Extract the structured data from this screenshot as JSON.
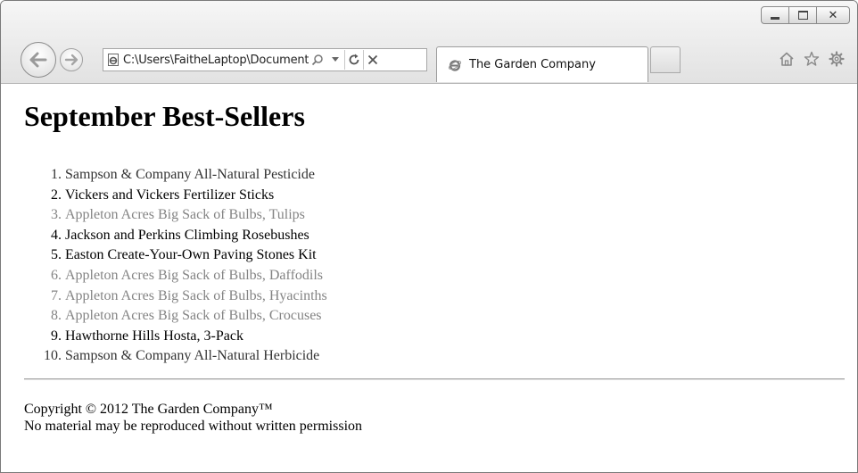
{
  "browser": {
    "address_bar": {
      "url": "C:\\Users\\FaitheLaptop\\Documents\\M"
    },
    "tab": {
      "title": "The Garden Company"
    },
    "toolbar_icons": [
      "home-icon",
      "star-icon",
      "gear-icon"
    ]
  },
  "page": {
    "heading": "September Best-Sellers",
    "items": [
      {
        "num": "1.",
        "text": "Sampson & Company All-Natural Pesticide"
      },
      {
        "num": "2.",
        "text": "Vickers and Vickers Fertilizer Sticks"
      },
      {
        "num": "3.",
        "text": "Appleton Acres Big Sack of Bulbs, Tulips"
      },
      {
        "num": "4.",
        "text": "Jackson and Perkins Climbing Rosebushes"
      },
      {
        "num": "5.",
        "text": "Easton Create-Your-Own Paving Stones Kit"
      },
      {
        "num": "6.",
        "text": "Appleton Acres Big Sack of Bulbs, Daffodils"
      },
      {
        "num": "7.",
        "text": "Appleton Acres Big Sack of Bulbs, Hyacinths"
      },
      {
        "num": "8.",
        "text": "Appleton Acres Big Sack of Bulbs, Crocuses"
      },
      {
        "num": "9.",
        "text": "Hawthorne Hills Hosta, 3-Pack"
      },
      {
        "num": "10.",
        "text": "Sampson & Company All-Natural Herbicide"
      }
    ],
    "footer": {
      "copyright": "Copyright © 2012 The Garden Company™",
      "notice": "No material may be reproduced without written permission"
    }
  },
  "colors": {
    "item_dark": "#000000",
    "item_mid": "#333333",
    "item_gray": "#848484",
    "chrome": "#e6e6e6"
  }
}
